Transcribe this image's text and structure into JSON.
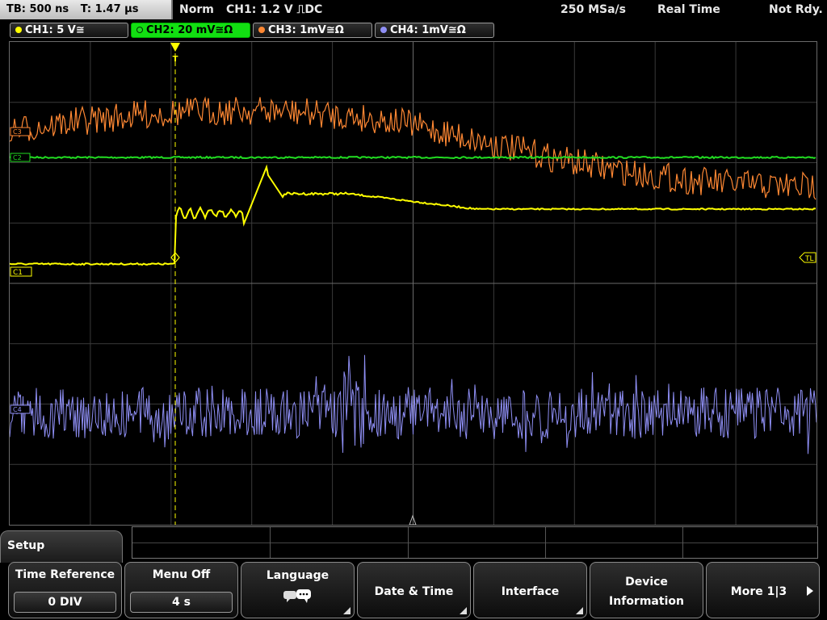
{
  "header": {
    "timebase": "TB: 500 ns",
    "trigger_time": "T: 1.47 µs",
    "mode": "Norm",
    "trigger": "CH1: 1.2 V ⎍DC",
    "sample_rate": "250 MSa/s",
    "acquisition": "Real Time",
    "status": "Not Rdy."
  },
  "channels": [
    {
      "label": "CH1: 5 V≅",
      "color": "#ffff00",
      "active": false
    },
    {
      "label": "CH2: 20 mV≅Ω",
      "color": "#22dd22",
      "active": true
    },
    {
      "label": "CH3: 1mV≅Ω",
      "color": "#ff8833",
      "active": false
    },
    {
      "label": "CH4: 1mV≅Ω",
      "color": "#8f8ff5",
      "active": false
    }
  ],
  "markers": {
    "ch1": "C1",
    "ch2": "C2",
    "ch3": "C3",
    "ch4": "C4",
    "trigger_level": "TL",
    "trigger_position": "T"
  },
  "menu": {
    "title": "Setup",
    "softkeys": [
      {
        "label": "Time Reference",
        "value": "0 DIV"
      },
      {
        "label": "Menu Off",
        "value": "4 s"
      },
      {
        "label": "Language",
        "icon": "speech-bubbles-icon"
      },
      {
        "label": "Date & Time"
      },
      {
        "label": "Interface"
      },
      {
        "label_line1": "Device",
        "label_line2": "Information"
      },
      {
        "label": "More 1|3",
        "icon": "arrow-right-icon"
      }
    ]
  },
  "colors": {
    "ch1": "#ffff00",
    "ch2": "#22dd22",
    "ch3": "#ff8833",
    "ch4": "#8f8ff5",
    "grid": "#555555"
  }
}
